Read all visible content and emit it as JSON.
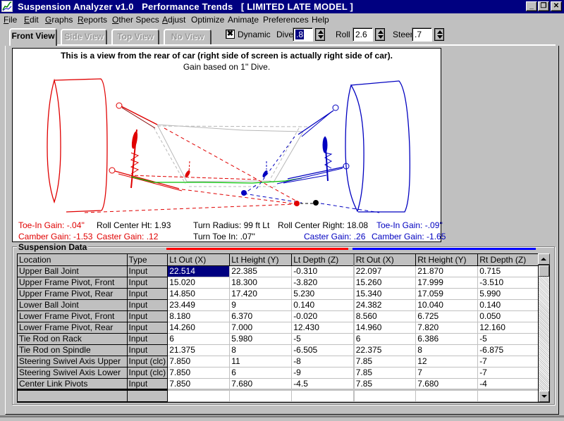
{
  "window": {
    "title": "Suspension Analyzer v1.0   Performance Trends   [ LIMITED LATE MODEL ]",
    "controls": [
      "minimize",
      "restore",
      "close"
    ]
  },
  "menu": [
    {
      "label": "File",
      "accel": "F"
    },
    {
      "label": "Edit",
      "accel": "E"
    },
    {
      "label": "Graphs",
      "accel": "G"
    },
    {
      "label": "Reports",
      "accel": "R"
    },
    {
      "label": "Other Specs",
      "accel": "O"
    },
    {
      "label": "Adjust",
      "accel": "A"
    },
    {
      "label": "Optimize",
      "accel": ""
    },
    {
      "label": "Animate",
      "accel": "t"
    },
    {
      "label": "Preferences",
      "accel": ""
    },
    {
      "label": "Help",
      "accel": ""
    }
  ],
  "tabs": [
    {
      "label": "Front View",
      "state": "active"
    },
    {
      "label": "Side View",
      "state": "disabled"
    },
    {
      "label": "Top View",
      "state": "disabled"
    },
    {
      "label": "No View",
      "state": "disabled"
    }
  ],
  "controls": {
    "dynamic": {
      "label": "Dynamic",
      "checked": true,
      "mark": "✖"
    },
    "dive": {
      "label": "Dive",
      "value": ".8"
    },
    "roll": {
      "label": "Roll",
      "value": "2.6"
    },
    "steer": {
      "label": "Steer",
      "value": ".7"
    }
  },
  "view": {
    "title": "This is a view from the rear of car (right side of screen is actually right side of car).",
    "subtitle": "Gain based on 1'' Dive.",
    "left_color": "#e00000",
    "right_color": "#0000c0",
    "stats": {
      "lt_toe_in_gain": "Toe-In Gain: -.04''",
      "lt_camber_gain": "Camber Gain: -1.53",
      "roll_center_ht": "Roll Center Ht: 1.93",
      "lt_caster_gain": "Caster Gain: .12",
      "turn_radius": "Turn Radius: 99 ft Lt",
      "turn_toe_in": "Turn Toe In: .07''",
      "roll_center_right": "Roll Center Right: 18.08",
      "rt_caster_gain": "Caster Gain: .26",
      "rt_toe_in_gain": "Toe-In Gain: -.09''",
      "rt_camber_gain": "Camber Gain: -1.65"
    }
  },
  "suspension_data": {
    "title": "Suspension Data",
    "columns": [
      "Location",
      "Type",
      "Lt Out (X)",
      "Lt Height (Y)",
      "Lt Depth (Z)",
      "Rt Out (X)",
      "Rt Height (Y)",
      "Rt Depth (Z)"
    ],
    "rows": [
      [
        "Upper Ball Joint",
        "Input",
        "22.514",
        "22.385",
        "-0.310",
        "22.097",
        "21.870",
        "0.715"
      ],
      [
        "Upper Frame Pivot, Front",
        "Input",
        "15.020",
        "18.300",
        "-3.820",
        "15.260",
        "17.999",
        "-3.510"
      ],
      [
        "Upper Frame Pivot, Rear",
        "Input",
        "14.850",
        "17.420",
        "5.230",
        "15.340",
        "17.059",
        "5.990"
      ],
      [
        "Lower Ball Joint",
        "Input",
        "23.449",
        "9",
        "0.140",
        "24.382",
        "10.040",
        "0.140"
      ],
      [
        "Lower Frame Pivot, Front",
        "Input",
        "8.180",
        "6.370",
        "-0.020",
        "8.560",
        "6.725",
        "0.050"
      ],
      [
        "Lower Frame Pivot, Rear",
        "Input",
        "14.260",
        "7.000",
        "12.430",
        "14.960",
        "7.820",
        "12.160"
      ],
      [
        "Tie Rod on Rack",
        "Input",
        "6",
        "5.980",
        "-5",
        "6",
        "6.386",
        "-5"
      ],
      [
        "Tie Rod on Spindle",
        "Input",
        "21.375",
        "8",
        "-6.505",
        "22.375",
        "8",
        "-6.875"
      ],
      [
        "Steering Swivel Axis Upper",
        "Input (clc)",
        "7.850",
        "11",
        "-8",
        "7.85",
        "12",
        "-7"
      ],
      [
        "Steering Swivel Axis Lower",
        "Input (clc)",
        "7.850",
        "6",
        "-9",
        "7.85",
        "7",
        "-7"
      ],
      [
        "Center Link Pivots",
        "Input",
        "7.850",
        "7.680",
        "-4.5",
        "7.85",
        "7.680",
        "-4"
      ]
    ],
    "selected_cell": "22.514"
  }
}
